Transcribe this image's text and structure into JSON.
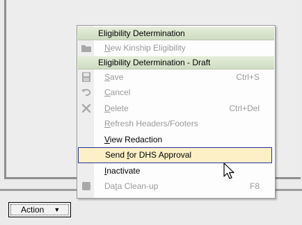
{
  "action_button": {
    "label": "Action",
    "arrow": "▼"
  },
  "menu": {
    "section1_header": "Eligibility Determination",
    "section2_header": "Eligibility Determination - Draft",
    "items": {
      "new_kinship": {
        "pre": "",
        "key": "N",
        "post": "ew Kinship Eligibility",
        "icon": "folder-icon"
      },
      "save": {
        "pre": "",
        "key": "S",
        "post": "ave",
        "shortcut": "Ctrl+S",
        "icon": "save-disk-icon"
      },
      "cancel": {
        "pre": "",
        "key": "C",
        "post": "ancel",
        "icon": "undo-icon"
      },
      "delete": {
        "pre": "",
        "key": "D",
        "post": "elete",
        "shortcut": "Ctrl+Del",
        "icon": "delete-x-icon"
      },
      "refresh": {
        "pre": "",
        "key": "R",
        "post": "efresh Headers/Footers"
      },
      "view_redaction": {
        "pre": "",
        "key": "V",
        "post": "iew Redaction"
      },
      "send_dhs": {
        "pre": "Send ",
        "key": "f",
        "post": "or DHS Approval"
      },
      "inactivate": {
        "pre": "",
        "key": "I",
        "post": "nactivate"
      },
      "data_cleanup": {
        "pre": "Da",
        "key": "t",
        "post": "a Clean-up",
        "shortcut": "F8",
        "icon": "square-icon"
      }
    }
  },
  "colors": {
    "header_bg": "#d6e2ca",
    "hover_bg": "#fdf0c6",
    "hover_border": "#23319a",
    "disabled_text": "#9a9a9a"
  }
}
